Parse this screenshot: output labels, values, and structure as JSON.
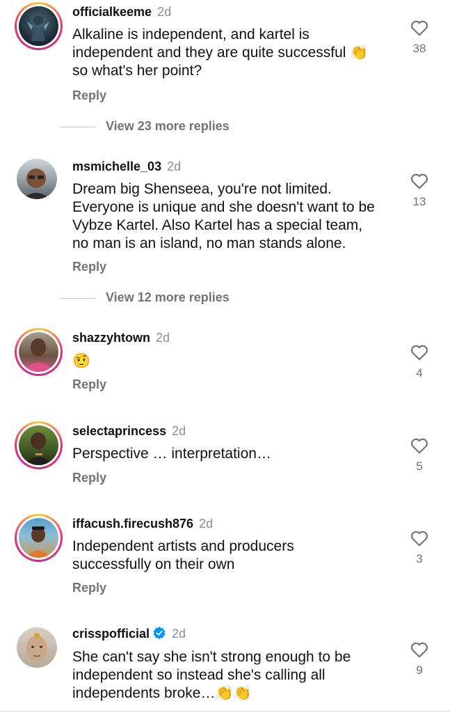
{
  "comments": [
    {
      "username": "officialkeeme",
      "time": "2d",
      "lines": [
        "Alkaline is independent, and kartel is",
        "independent and they are quite successful 👏",
        "so what's her point?"
      ],
      "reply": "Reply",
      "likes": "38",
      "view_more": "View 23 more replies"
    },
    {
      "username": "msmichelle_03",
      "time": "2d",
      "lines": [
        "Dream big Shenseea, you're not limited.",
        "Everyone is unique and she doesn't want to be",
        "Vybze Kartel. Also Kartel has a special team,",
        "no man is an island, no man stands alone."
      ],
      "reply": "Reply",
      "likes": "13",
      "view_more": "View 12 more replies"
    },
    {
      "username": "shazzyhtown",
      "time": "2d",
      "lines": [
        "🤨"
      ],
      "reply": "Reply",
      "likes": "4"
    },
    {
      "username": "selectaprincess",
      "time": "2d",
      "lines": [
        "Perspective … interpretation…"
      ],
      "reply": "Reply",
      "likes": "5"
    },
    {
      "username": "iffacush.firecush876",
      "time": "2d",
      "lines": [
        "Independent artists and producers",
        "successfully on their own"
      ],
      "reply": "Reply",
      "likes": "3"
    },
    {
      "username": "crisspofficial",
      "time": "2d",
      "lines": [
        "She can't say she isn't strong enough to be",
        "independent so instead she's calling all",
        "independents broke…👏👏"
      ],
      "likes": "9",
      "verified": true
    }
  ],
  "icons": {
    "like": "heart-outline-icon",
    "verified": "verified-badge-icon"
  },
  "colors": {
    "text": "#111111",
    "muted": "#737373",
    "verified": "#0095f6"
  }
}
